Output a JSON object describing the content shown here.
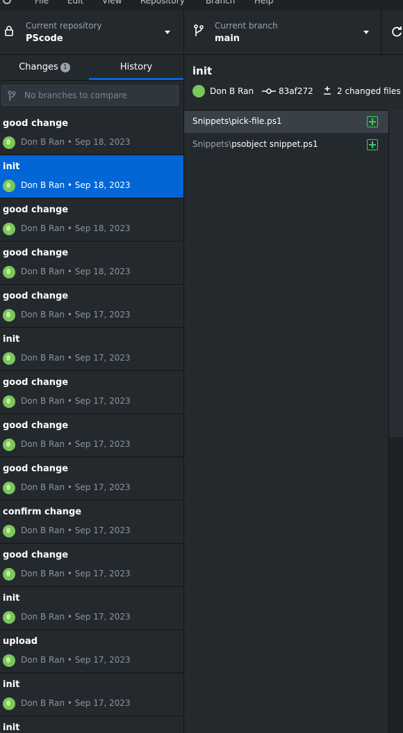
{
  "menu": {
    "items": [
      "File",
      "Edit",
      "View",
      "Repository",
      "Branch",
      "Help"
    ]
  },
  "toolbar": {
    "repo_label": "Current repository",
    "repo_value": "PScode",
    "branch_label": "Current branch",
    "branch_value": "main"
  },
  "tabs": {
    "changes_label": "Changes",
    "changes_count": "1",
    "history_label": "History"
  },
  "compare": {
    "placeholder": "No branches to compare"
  },
  "commits": [
    {
      "title": "good change",
      "meta": "Don B Ran • Sep 18, 2023"
    },
    {
      "title": "init",
      "meta": "Don B Ran • Sep 18, 2023"
    },
    {
      "title": "good change",
      "meta": "Don B Ran • Sep 18, 2023"
    },
    {
      "title": "good change",
      "meta": "Don B Ran • Sep 18, 2023"
    },
    {
      "title": "good change",
      "meta": "Don B Ran • Sep 17, 2023"
    },
    {
      "title": "init",
      "meta": "Don B Ran • Sep 17, 2023"
    },
    {
      "title": "good change",
      "meta": "Don B Ran • Sep 17, 2023"
    },
    {
      "title": "good change",
      "meta": "Don B Ran • Sep 17, 2023"
    },
    {
      "title": "good change",
      "meta": "Don B Ran • Sep 17, 2023"
    },
    {
      "title": "confirm change",
      "meta": "Don B Ran • Sep 17, 2023"
    },
    {
      "title": "good change",
      "meta": "Don B Ran • Sep 17, 2023"
    },
    {
      "title": "init",
      "meta": "Don B Ran • Sep 17, 2023"
    },
    {
      "title": "upload",
      "meta": "Don B Ran • Sep 17, 2023"
    },
    {
      "title": "init",
      "meta": "Don B Ran • Sep 17, 2023"
    },
    {
      "title": "init",
      "meta": ""
    }
  ],
  "detail": {
    "title": "init",
    "author": "Don B Ran",
    "sha": "83af272",
    "changed_files": "2 changed files"
  },
  "files": [
    {
      "dir": "Snippets\\",
      "name": "pick-file.ps1",
      "status_icon": "file-added-icon"
    },
    {
      "dir": "Snippets\\",
      "name": "psobject snippet.ps1",
      "status_icon": "file-added-icon"
    }
  ],
  "colors": {
    "accent": "#0366d6",
    "added": "#34d058",
    "avatar": "#7cc75a"
  }
}
